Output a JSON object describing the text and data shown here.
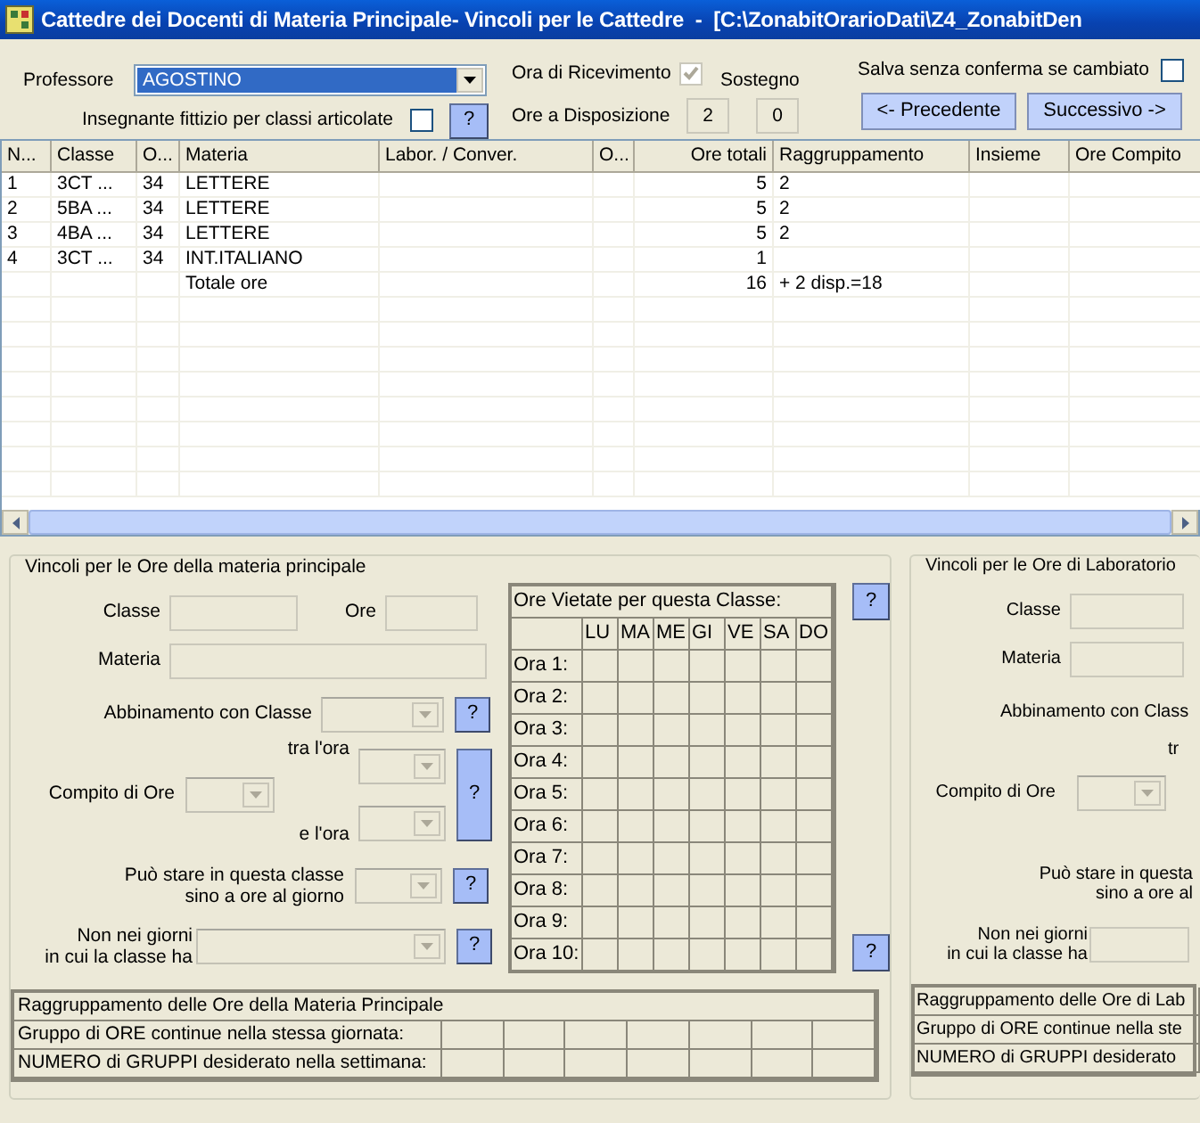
{
  "window": {
    "title": "Cattedre dei Docenti di Materia Principale- Vincoli per le Cattedre  -  [C:\\ZonabitOrarioDati\\Z4_ZonabitDen"
  },
  "header": {
    "professore": {
      "label": "Professore",
      "value": "AGOSTINO"
    },
    "fittizio": {
      "label": "Insegnante fittizio per classi articolate",
      "checked": false
    },
    "fittizio_help": "?",
    "ora_ricevimento": {
      "label": "Ora di Ricevimento",
      "checked": true,
      "disabled": true
    },
    "sostegno": {
      "label": "Sostegno",
      "value": "0"
    },
    "ore_disposizione": {
      "label": "Ore a Disposizione",
      "value": "2"
    },
    "salva": {
      "label": "Salva senza conferma se cambiato",
      "checked": false
    },
    "buttons": [
      "<- Precedente",
      "Successivo ->"
    ]
  },
  "table": {
    "columns": [
      "N...",
      "Classe",
      "O...",
      "Materia",
      "Labor. / Conver.",
      "O...",
      "Ore totali",
      "Raggruppamento",
      "Insieme",
      "Ore Compito"
    ],
    "rows": [
      {
        "n": "1",
        "classe": "3CT ...",
        "o": "34",
        "materia": "LETTERE",
        "ore_totali": "5",
        "raggruppamento": "2"
      },
      {
        "n": "2",
        "classe": "5BA ...",
        "o": "34",
        "materia": "LETTERE",
        "ore_totali": "5",
        "raggruppamento": "2"
      },
      {
        "n": "3",
        "classe": "4BA ...",
        "o": "34",
        "materia": "LETTERE",
        "ore_totali": "5",
        "raggruppamento": "2"
      },
      {
        "n": "4",
        "classe": "3CT ...",
        "o": "34",
        "materia": "INT.ITALIANO",
        "ore_totali": "1"
      },
      {
        "materia": "Totale ore",
        "ore_totali": "16",
        "raggruppamento": "+ 2 disp.=18"
      }
    ]
  },
  "main_panel": {
    "title": "Vincoli per le Ore della materia principale",
    "classe_label": "Classe",
    "ore_label": "Ore",
    "materia_label": "Materia",
    "abbinamento_label": "Abbinamento con Classe",
    "compito_label": "Compito di Ore",
    "tra_label": "tra l'ora",
    "e_label": "e l'ora",
    "puo_stare_label": "Può stare in questa classe\nsino a ore al giorno",
    "non_giorni_label": "Non nei giorni\nin cui la classe ha",
    "help_buttons": [
      "?",
      "?",
      "?",
      "?"
    ],
    "grid": {
      "title": "Ore Vietate per questa Classe:",
      "days": [
        "LU",
        "MA",
        "ME",
        "GI",
        "VE",
        "SA",
        "DO"
      ],
      "hours": [
        "Ora 1:",
        "Ora 2:",
        "Ora 3:",
        "Ora 4:",
        "Ora 5:",
        "Ora 6:",
        "Ora 7:",
        "Ora 8:",
        "Ora 9:",
        "Ora 10:"
      ],
      "help_buttons": [
        "?",
        "?"
      ]
    },
    "grouping": {
      "title": "Raggruppamento delle Ore della Materia Principale",
      "rows": [
        "Gruppo di ORE continue nella stessa giornata:",
        "NUMERO di GRUPPI desiderato nella settimana:"
      ]
    }
  },
  "lab_panel": {
    "title": "Vincoli per le Ore di Laboratorio",
    "classe_label": "Classe",
    "materia_label": "Materia",
    "abbinamento_label": "Abbinamento con Class",
    "tra_label": "tr",
    "compito_label": "Compito di Ore",
    "puo_stare_label": "Può stare in questa\nsino a ore al",
    "non_giorni_label": "Non nei giorni\nin cui la classe ha",
    "grouping": {
      "title": "Raggruppamento delle Ore di Lab",
      "rows": [
        "Gruppo di ORE continue nella ste",
        "NUMERO di GRUPPI desiderato"
      ]
    }
  }
}
